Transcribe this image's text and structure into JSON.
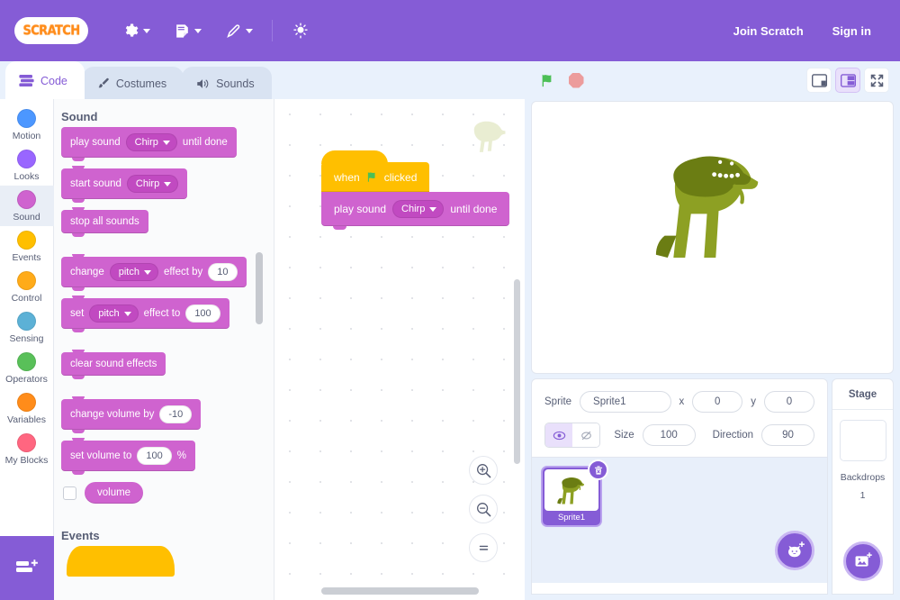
{
  "menubar": {
    "logo_text": "SCRATCH",
    "items": [
      {
        "name": "settings",
        "icon": "globe-gear-icon"
      },
      {
        "name": "file",
        "icon": "file-icon"
      },
      {
        "name": "edit",
        "icon": "pencil-icon"
      },
      {
        "name": "tutorials",
        "icon": "lightbulb-icon"
      }
    ],
    "join": "Join Scratch",
    "signin": "Sign in"
  },
  "tabs": [
    {
      "label": "Code",
      "icon": "code-blocks-icon",
      "active": true
    },
    {
      "label": "Costumes",
      "icon": "paintbrush-icon",
      "active": false
    },
    {
      "label": "Sounds",
      "icon": "speaker-icon",
      "active": false
    }
  ],
  "stage_controls": {
    "go": "green-flag-icon",
    "stop": "stop-icon",
    "small_stage": "small-stage-icon",
    "large_stage": "large-stage-icon",
    "fullscreen": "fullscreen-icon",
    "selected_layout": "large"
  },
  "categories": [
    {
      "label": "Motion",
      "color": "#4c97ff",
      "selected": false
    },
    {
      "label": "Looks",
      "color": "#9966ff",
      "selected": false
    },
    {
      "label": "Sound",
      "color": "#cf63cf",
      "selected": true
    },
    {
      "label": "Events",
      "color": "#ffbf00",
      "selected": false
    },
    {
      "label": "Control",
      "color": "#ffab19",
      "selected": false
    },
    {
      "label": "Sensing",
      "color": "#5cb1d6",
      "selected": false
    },
    {
      "label": "Operators",
      "color": "#59c059",
      "selected": false
    },
    {
      "label": "Variables",
      "color": "#ff8c1a",
      "selected": false
    },
    {
      "label": "My Blocks",
      "color": "#ff6680",
      "selected": false
    }
  ],
  "extension_button": {
    "label": "add-extension",
    "icon": "blocks-plus-icon"
  },
  "palette": {
    "section_title": "Sound",
    "blocks": [
      {
        "id": "play-sound-until-done",
        "parts": [
          {
            "type": "text",
            "value": "play sound"
          },
          {
            "type": "dropdown",
            "value": "Chirp"
          },
          {
            "type": "text",
            "value": "until done"
          }
        ]
      },
      {
        "id": "start-sound",
        "parts": [
          {
            "type": "text",
            "value": "start sound"
          },
          {
            "type": "dropdown",
            "value": "Chirp"
          }
        ]
      },
      {
        "id": "stop-all-sounds",
        "parts": [
          {
            "type": "text",
            "value": "stop all sounds"
          }
        ]
      },
      {
        "id": "change-effect-by",
        "parts": [
          {
            "type": "text",
            "value": "change"
          },
          {
            "type": "dropdown",
            "value": "pitch"
          },
          {
            "type": "text",
            "value": "effect by"
          },
          {
            "type": "number",
            "value": "10"
          }
        ]
      },
      {
        "id": "set-effect-to",
        "parts": [
          {
            "type": "text",
            "value": "set"
          },
          {
            "type": "dropdown",
            "value": "pitch"
          },
          {
            "type": "text",
            "value": "effect to"
          },
          {
            "type": "number",
            "value": "100"
          }
        ]
      },
      {
        "id": "clear-sound-effects",
        "parts": [
          {
            "type": "text",
            "value": "clear sound effects"
          }
        ]
      },
      {
        "id": "change-volume-by",
        "parts": [
          {
            "type": "text",
            "value": "change volume by"
          },
          {
            "type": "number",
            "value": "-10"
          }
        ]
      },
      {
        "id": "set-volume-to",
        "parts": [
          {
            "type": "text",
            "value": "set volume to"
          },
          {
            "type": "number",
            "value": "100"
          },
          {
            "type": "text",
            "value": "%"
          }
        ]
      }
    ],
    "monitor": {
      "label": "volume",
      "checked": false
    },
    "next_section_title": "Events"
  },
  "script": {
    "hat": {
      "prefix": "when",
      "icon": "green-flag-icon",
      "suffix": "clicked"
    },
    "block": {
      "prefix": "play sound",
      "dropdown": "Chirp",
      "suffix": "until done"
    }
  },
  "zoom_controls": [
    {
      "name": "zoom-in",
      "glyph": "+"
    },
    {
      "name": "zoom-out",
      "glyph": "−"
    },
    {
      "name": "zoom-reset",
      "glyph": "="
    }
  ],
  "sprite_info": {
    "sprite_label": "Sprite",
    "sprite_name": "Sprite1",
    "x_label": "x",
    "x_value": "0",
    "y_label": "y",
    "y_value": "0",
    "size_label": "Size",
    "size_value": "100",
    "direction_label": "Direction",
    "direction_value": "90",
    "show_icon": "eye-icon",
    "hide_icon": "eye-slash-icon",
    "visible": true
  },
  "sprite_list": [
    {
      "name": "Sprite1",
      "selected": true,
      "delete_icon": "trash-icon"
    }
  ],
  "add_sprite_button": {
    "name": "add-sprite",
    "icon": "cat-plus-icon"
  },
  "stage_selector": {
    "header": "Stage",
    "backdrops_label": "Backdrops",
    "backdrops_count": "1",
    "add_backdrop_button": {
      "name": "add-backdrop",
      "icon": "image-plus-icon"
    }
  },
  "colors": {
    "brand_purple": "#855cd6",
    "sound_block": "#cf63cf",
    "events_block": "#ffbf00",
    "stage_bg": "#e9f1fc",
    "text": "#575e75",
    "dino_body": "#8da023",
    "dino_head": "#6b7d13"
  }
}
